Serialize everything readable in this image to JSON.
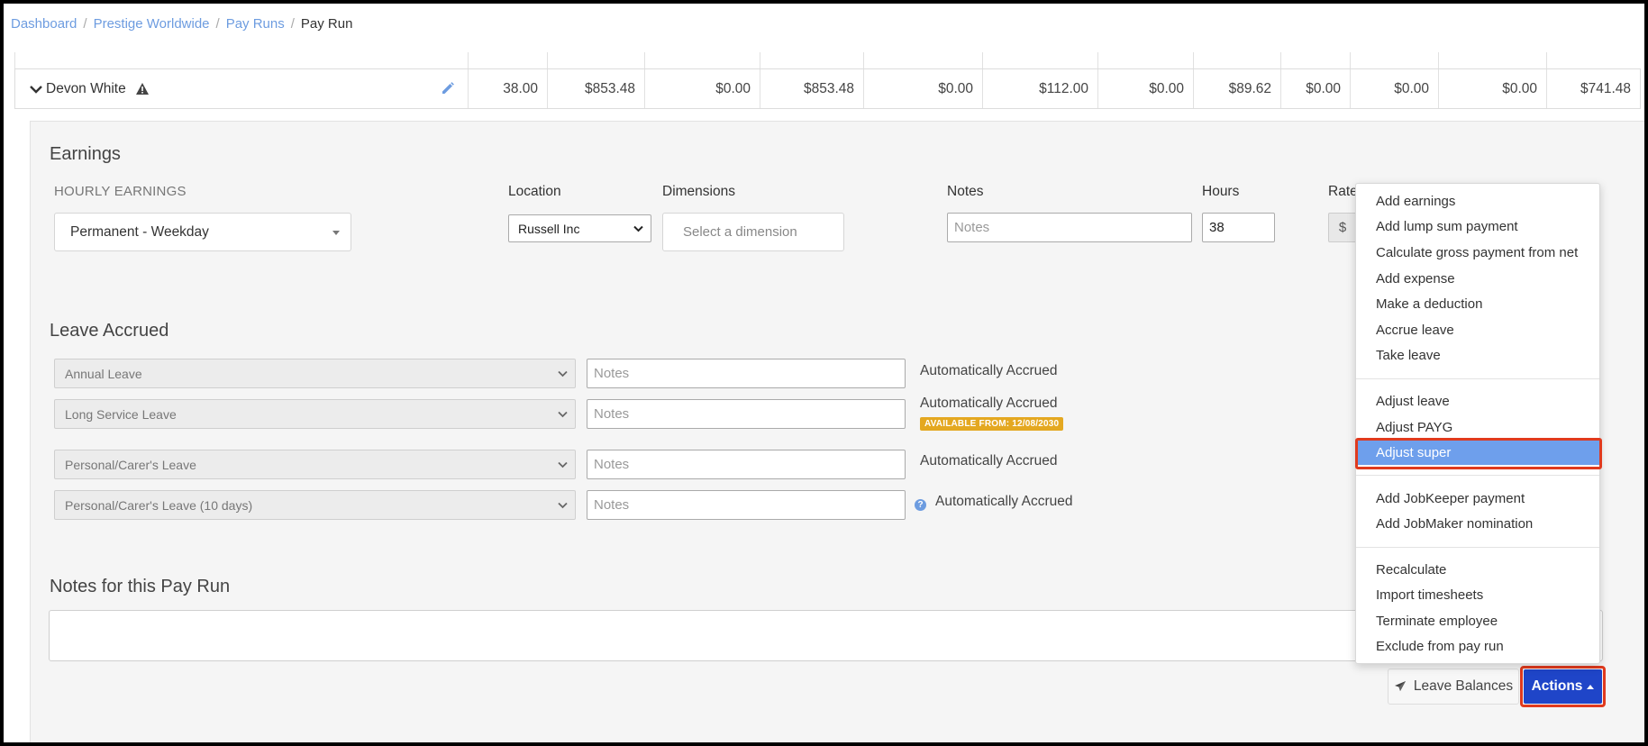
{
  "breadcrumb": {
    "items": [
      "Dashboard",
      "Prestige Worldwide",
      "Pay Runs"
    ],
    "current": "Pay Run",
    "separator": "/"
  },
  "employee_row": {
    "name": "Devon White",
    "values": [
      "38.00",
      "$853.48",
      "$0.00",
      "$853.48",
      "$0.00",
      "$112.00",
      "$0.00",
      "$89.62",
      "$0.00",
      "$0.00",
      "$0.00",
      "$741.48"
    ]
  },
  "earnings": {
    "title": "Earnings",
    "hourly_label": "HOURLY EARNINGS",
    "pay_category": "Permanent - Weekday",
    "location_label": "Location",
    "location_value": "Russell Inc",
    "dimensions_label": "Dimensions",
    "dimensions_placeholder": "Select a dimension",
    "notes_label": "Notes",
    "notes_placeholder": "Notes",
    "hours_label": "Hours",
    "hours_value": "38",
    "rate_label": "Rate",
    "rate_prefix": "$"
  },
  "leave_accrued": {
    "title": "Leave Accrued",
    "rows": [
      {
        "leave_type": "Annual Leave",
        "notes_placeholder": "Notes",
        "status": "Automatically Accrued"
      },
      {
        "leave_type": "Long Service Leave",
        "notes_placeholder": "Notes",
        "status": "Automatically Accrued",
        "badge": "AVAILABLE FROM: 12/08/2030"
      },
      {
        "leave_type": "Personal/Carer's Leave",
        "notes_placeholder": "Notes",
        "status": "Automatically Accrued"
      },
      {
        "leave_type": "Personal/Carer's Leave (10 days)",
        "notes_placeholder": "Notes",
        "status": "Automatically Accrued",
        "help": "?"
      }
    ]
  },
  "pay_run_notes": {
    "title": "Notes for this Pay Run"
  },
  "buttons": {
    "leave_balances": "Leave Balances",
    "actions": "Actions"
  },
  "actions_menu": {
    "groups": [
      [
        "Add earnings",
        "Add lump sum payment",
        "Calculate gross payment from net",
        "Add expense",
        "Make a deduction",
        "Accrue leave",
        "Take leave"
      ],
      [
        "Adjust leave",
        "Adjust PAYG",
        "Adjust super"
      ],
      [
        "Add JobKeeper payment",
        "Add JobMaker nomination"
      ],
      [
        "Recalculate",
        "Import timesheets",
        "Terminate employee",
        "Exclude from pay run"
      ]
    ],
    "highlighted": "Adjust super"
  },
  "colors": {
    "link": "#6d9ce0",
    "primary_button": "#1f45c8",
    "menu_highlight": "#6e9fec",
    "annotation_outline": "#e03a1e",
    "badge": "#e4a821"
  }
}
